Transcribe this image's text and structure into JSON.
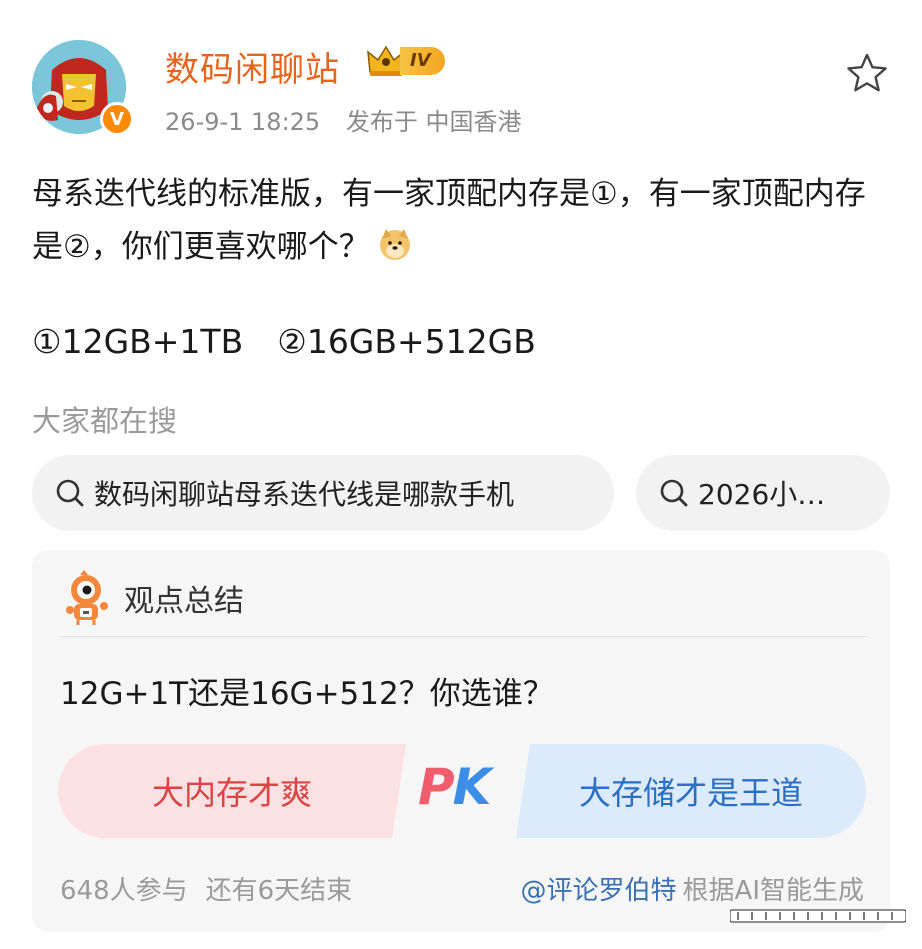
{
  "post": {
    "author": "数码闲聊站",
    "level": "IV",
    "date": "26-9-1 18:25",
    "location": "发布于 中国香港",
    "text": "母系迭代线的标准版，有一家顶配内存是①，有一家顶配内存是②，你们更喜欢哪个？",
    "option_1": "①12GB+1TB",
    "option_2": "②16GB+512GB"
  },
  "search": {
    "title": "大家都在搜",
    "chips": [
      "数码闲聊站母系迭代线是哪款手机",
      "2026小…"
    ]
  },
  "summary": {
    "title": "观点总结",
    "question": "12G+1T还是16G+512？你选谁？",
    "left_option": "大内存才爽",
    "right_option": "大存储才是王道",
    "pk": "PK",
    "participants": "648人参与",
    "remaining": "还有6天结束",
    "mention": "@评论罗伯特",
    "ai_note": "根据AI智能生成"
  },
  "colors": {
    "author": "#e8641d",
    "vote_left_bg": "#fbe1e1",
    "vote_left_text": "#d94545",
    "vote_right_bg": "#dcebfb",
    "vote_right_text": "#2b6fc4",
    "mention": "#3a6fb0"
  },
  "icons": {
    "avatar": "iron-man-avatar",
    "verified": "verified-badge-icon",
    "favorite": "star-outline-icon",
    "search": "search-icon",
    "ai": "robot-mascot-icon",
    "emoji": "doge-emoji-icon"
  }
}
